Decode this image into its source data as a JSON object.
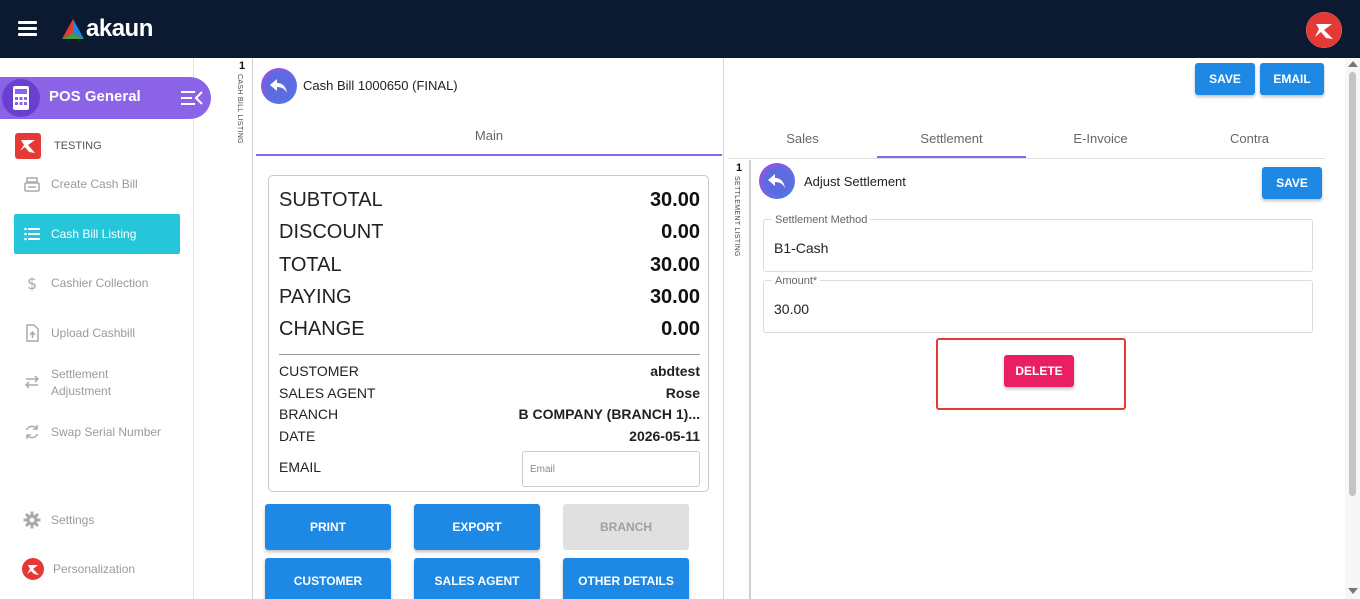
{
  "app": {
    "logo_text": "akaun",
    "brand_color": "#0b1a30"
  },
  "sidebar": {
    "module_title": "POS General",
    "company": "TESTING",
    "items": [
      {
        "label": "Create Cash Bill",
        "icon": "cash-register-icon",
        "active": false
      },
      {
        "label": "Cash Bill Listing",
        "icon": "list-icon",
        "active": true
      },
      {
        "label": "Cashier Collection",
        "icon": "dollar-icon",
        "active": false
      },
      {
        "label": "Upload Cashbill",
        "icon": "upload-icon",
        "active": false
      },
      {
        "label": "Settlement Adjustment",
        "icon": "arrows-icon",
        "active": false
      },
      {
        "label": "Swap Serial Number",
        "icon": "refresh-icon",
        "active": false
      }
    ],
    "settings_label": "Settings",
    "personalization_label": "Personalization",
    "active_color": "#26c6da"
  },
  "cash_bill_listing_strip": {
    "number": "1",
    "label": "CASH BILL LISTING"
  },
  "bill": {
    "title": "Cash Bill 1000650 (FINAL)",
    "tab_main": "Main",
    "summary": [
      {
        "label": "SUBTOTAL",
        "value": "30.00"
      },
      {
        "label": "DISCOUNT",
        "value": "0.00"
      },
      {
        "label": "TOTAL",
        "value": "30.00"
      },
      {
        "label": "PAYING",
        "value": "30.00"
      },
      {
        "label": "CHANGE",
        "value": "0.00"
      }
    ],
    "info": [
      {
        "label": "CUSTOMER",
        "value": "abdtest"
      },
      {
        "label": "SALES AGENT",
        "value": "Rose"
      },
      {
        "label": "BRANCH",
        "value": "B COMPANY (BRANCH 1)..."
      },
      {
        "label": "DATE",
        "value": "2026-05-11"
      }
    ],
    "email_label": "EMAIL",
    "email_placeholder": "Email",
    "email_value": "",
    "buttons": {
      "print": "PRINT",
      "export": "EXPORT",
      "branch": "BRANCH",
      "customer": "CUSTOMER",
      "sales_agent": "SALES AGENT",
      "other_details": "OTHER DETAILS"
    }
  },
  "right": {
    "save_label": "SAVE",
    "email_label": "EMAIL",
    "tabs": [
      "Sales",
      "Settlement",
      "E-Invoice",
      "Contra"
    ],
    "active_tab": "Settlement",
    "settlement_strip": {
      "number": "1",
      "label": "SETTLEMENT LISTING"
    },
    "adjust_title": "Adjust Settlement",
    "adjust_save_label": "SAVE",
    "fields": {
      "method_label": "Settlement Method",
      "method_value": "B1-Cash",
      "amount_label": "Amount*",
      "amount_value": "30.00"
    },
    "delete_label": "DELETE",
    "delete_color": "#e91e63",
    "highlight_color": "#e53935"
  }
}
